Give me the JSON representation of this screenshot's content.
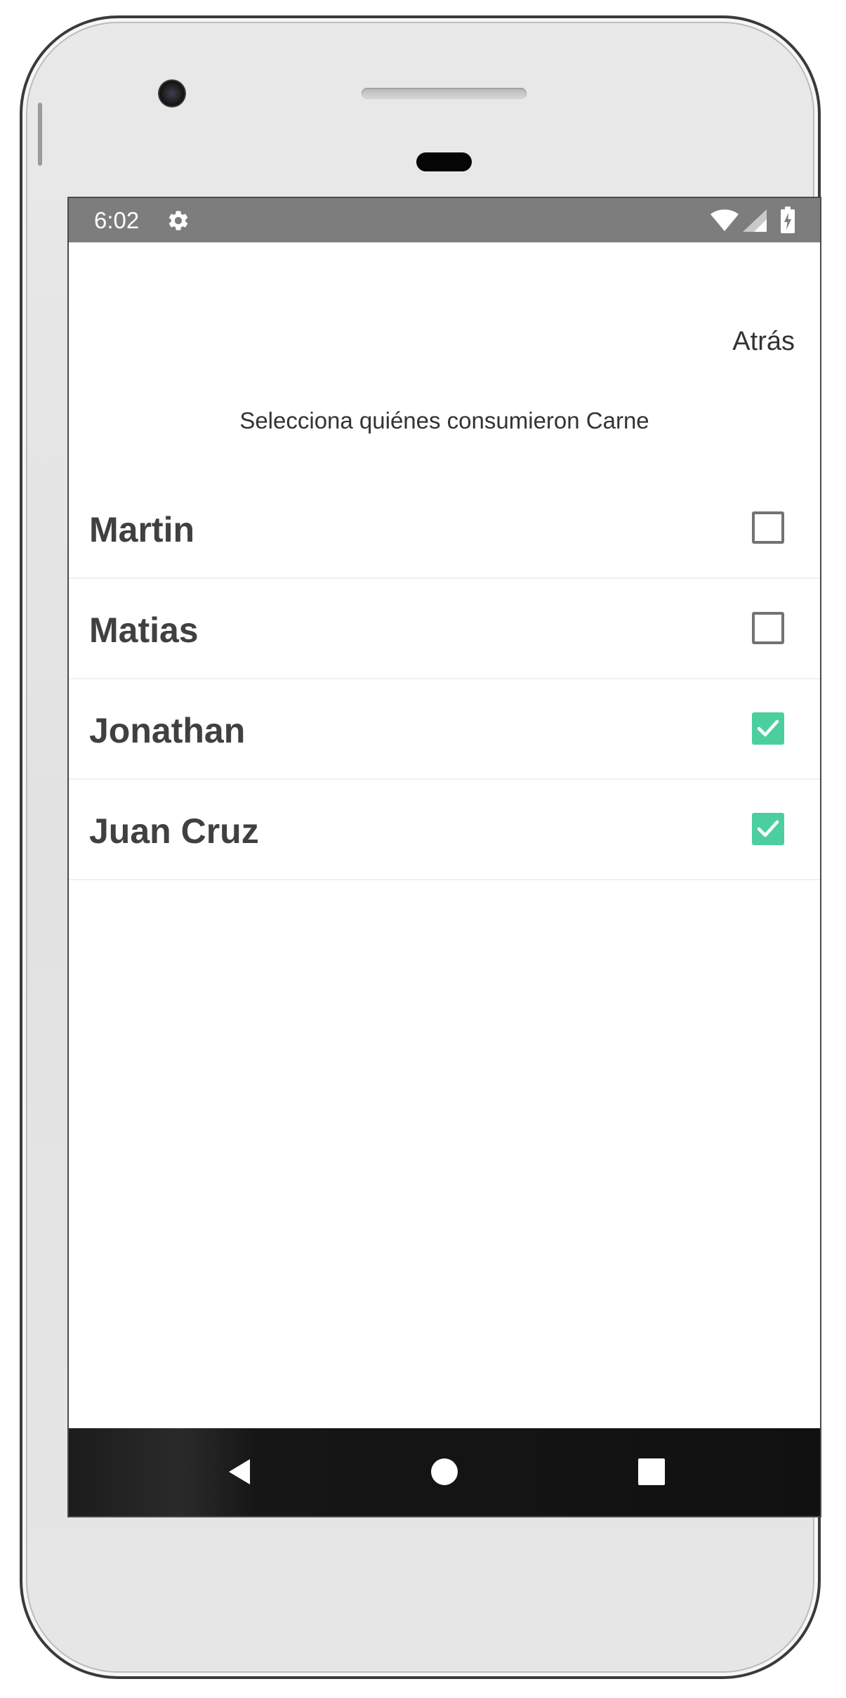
{
  "status_bar": {
    "time": "6:02",
    "icons": [
      "settings-gear-icon",
      "wifi-icon",
      "cell-signal-icon",
      "battery-charging-icon"
    ],
    "background": "#7d7d7d"
  },
  "header": {
    "back_label": "Atrás"
  },
  "subtitle": "Selecciona quiénes consumieron Carne",
  "people": [
    {
      "name": "Martin",
      "checked": false
    },
    {
      "name": "Matias",
      "checked": false
    },
    {
      "name": "Jonathan",
      "checked": true
    },
    {
      "name": "Juan Cruz",
      "checked": true
    }
  ],
  "nav_bar": {
    "buttons": [
      "back-triangle-icon",
      "home-circle-icon",
      "recents-square-icon"
    ]
  },
  "colors": {
    "checkbox_checked": "#4ccf9f",
    "checkbox_unchecked_border": "#737373",
    "name_text": "#404040"
  }
}
